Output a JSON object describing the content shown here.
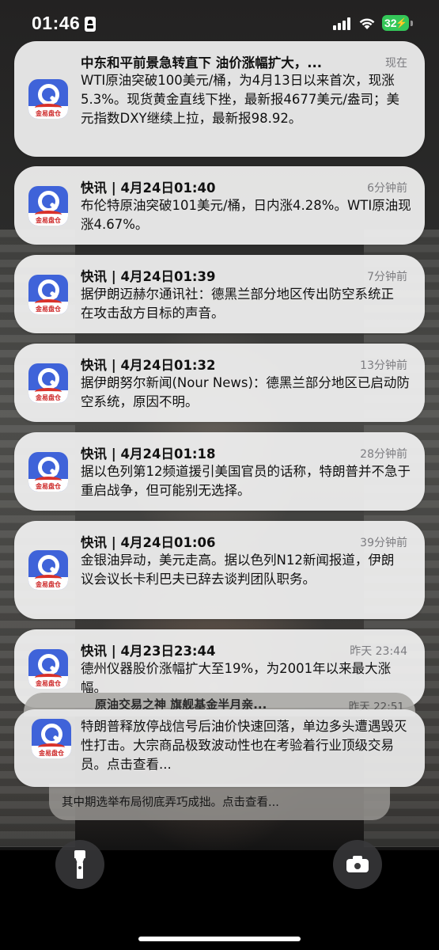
{
  "status_bar": {
    "time": "01:46",
    "battery": "32",
    "signal_icon": "cellular-signal-icon",
    "wifi_icon": "wifi-icon",
    "focus_icon": "id-card-icon"
  },
  "app": {
    "icon": "app-logo-icon",
    "brand_text": "金易盘仓",
    "brand_color": "#3f63d9",
    "accent_color": "#d9322b"
  },
  "notifications": [
    {
      "title": "中东和平前景急转直下 油价涨幅扩大，...",
      "time": "现在",
      "body": "WTI原油突破100美元/桶，为4月13日以来首次，现涨5.3%。现货黄金直线下挫，最新报4677美元/盎司；美元指数DXY继续上拉，最新报98.92。"
    },
    {
      "title": "快讯 | 4月24日01:40",
      "time": "6分钟前",
      "body": "布伦特原油突破101美元/桶，日内涨4.28%。WTI原油现涨4.67%。"
    },
    {
      "title": "快讯 | 4月24日01:39",
      "time": "7分钟前",
      "body": "据伊朗迈赫尔通讯社：德黑兰部分地区传出防空系统正在攻击敌方目标的声音。"
    },
    {
      "title": "快讯 | 4月24日01:32",
      "time": "13分钟前",
      "body": "据伊朗努尔新闻(Nour News)：德黑兰部分地区已启动防空系统，原因不明。"
    },
    {
      "title": "快讯 | 4月24日01:18",
      "time": "28分钟前",
      "body": "据以色列第12频道援引美国官员的话称，特朗普并不急于重启战争，但可能别无选择。"
    },
    {
      "title": "快讯 | 4月24日01:06",
      "time": "39分钟前",
      "body": "金银油异动，美元走高。据以色列N12新闻报道，伊朗议会议长卡利巴夫已辞去谈判团队职务。"
    },
    {
      "title": "快讯 | 4月23日23:44",
      "time": "昨天 23:44",
      "body": "德州仪器股价涨幅扩大至19%，为2001年以来最大涨幅。"
    }
  ],
  "stack": {
    "hidden_title": "原油交易之神 旗舰基金半月亲...",
    "hidden_time": "昨天 22:51",
    "front_body": "特朗普释放停战信号后油价快速回落，单边多头遭遇毁灭性打击。大宗商品极致波动性也在考验着行业顶级交易员。点击查看...",
    "back_body": "其中期选举布局彻底弄巧成拙。点击查看..."
  },
  "bottom_buttons": {
    "flashlight_icon": "flashlight-icon",
    "camera_icon": "camera-icon"
  }
}
